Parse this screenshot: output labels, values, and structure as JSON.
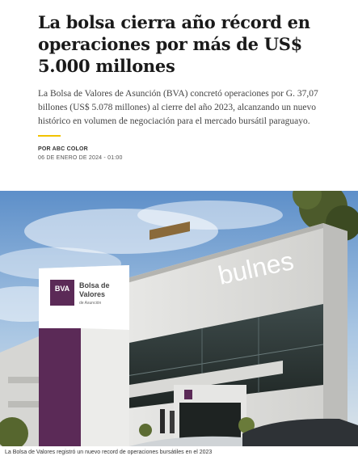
{
  "article": {
    "headline": "La bolsa cierra año récord en operaciones por más de US$ 5.000 millones",
    "lead": "La Bolsa de Valores de Asunción (BVA) concretó operaciones por G. 37,07 billones (US$ 5.078 millones) al cierre del año 2023, alcanzando un nuevo histórico en volumen de negociación para el mercado bursátil paraguayo.",
    "byline": "POR ABC COLOR",
    "date": "06 DE ENERO DE 2024 - 01:00"
  },
  "photo": {
    "caption": "La Bolsa de Valores registró un nuevo record de operaciones bursátiles en el 2023",
    "sign_logo": "BVA",
    "sign_text_line1": "Bolsa de",
    "sign_text_line2": "Valores",
    "sign_text_line3": "de Asunción",
    "building_sign": "bulnes"
  },
  "colors": {
    "accent": "#f2c200",
    "sign_purple": "#5b2a57"
  }
}
